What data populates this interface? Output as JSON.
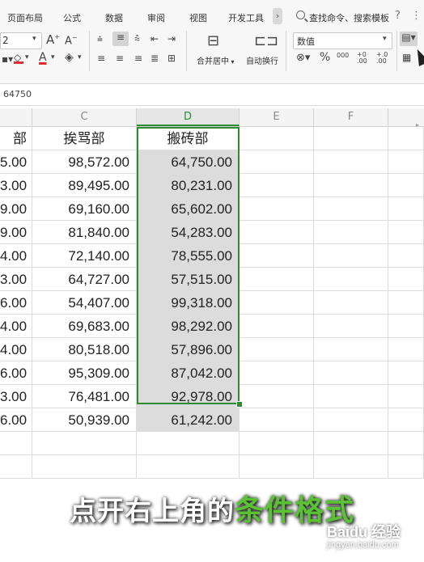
{
  "ribbon": {
    "tabs": [
      "页面布局",
      "公式",
      "数据",
      "审阅",
      "视图",
      "开发工具"
    ],
    "more_tabs": "›",
    "search_placeholder": "查找命令、搜索模板",
    "help": "?",
    "more": "⋮",
    "font_size": "2",
    "grow_font": "A",
    "shrink_font": "A",
    "merge_center": "合并居中",
    "wrap_text": "自动换行",
    "number_format": "数值",
    "percent": "%",
    "thousands": "000",
    "inc_decimal": "+0 .00",
    "dec_decimal": "+.0 .00"
  },
  "formula_bar": {
    "value": "64750"
  },
  "columns": [
    "C",
    "D",
    "E",
    "F"
  ],
  "headers": {
    "B": "部",
    "C": "挨骂部",
    "D": "搬砖部"
  },
  "rows": [
    {
      "b": "5.00",
      "c": "98,572.00",
      "d": "64,750.00"
    },
    {
      "b": "3.00",
      "c": "89,495.00",
      "d": "80,231.00"
    },
    {
      "b": "9.00",
      "c": "69,160.00",
      "d": "65,602.00"
    },
    {
      "b": "9.00",
      "c": "81,840.00",
      "d": "54,283.00"
    },
    {
      "b": "4.00",
      "c": "72,140.00",
      "d": "78,555.00"
    },
    {
      "b": "3.00",
      "c": "64,727.00",
      "d": "57,515.00"
    },
    {
      "b": "6.00",
      "c": "54,407.00",
      "d": "99,318.00"
    },
    {
      "b": "4.00",
      "c": "69,683.00",
      "d": "98,292.00"
    },
    {
      "b": "4.00",
      "c": "80,518.00",
      "d": "57,896.00"
    },
    {
      "b": "6.00",
      "c": "95,309.00",
      "d": "87,042.00"
    },
    {
      "b": "3.00",
      "c": "76,481.00",
      "d": "92,978.00"
    },
    {
      "b": "6.00",
      "c": "50,939.00",
      "d": "61,242.00"
    }
  ],
  "caption": {
    "prefix": "点开右上角的",
    "highlight": "条件格式"
  },
  "watermark": {
    "brand": "Baidu 经验",
    "url": "jingyan.baidu.com"
  },
  "colors": {
    "selection": "#2e8b32",
    "caption_highlight": "#5ac234"
  }
}
